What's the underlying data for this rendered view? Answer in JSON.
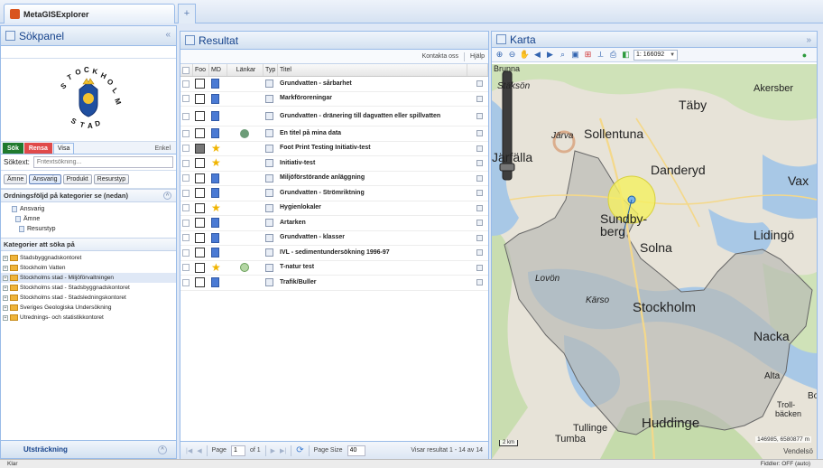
{
  "app": {
    "title": "MetaGISExplorer"
  },
  "left": {
    "title": "Sökpanel",
    "tabs": {
      "sok": "Sök",
      "rensa": "Rensa",
      "visa": "Visa",
      "enkel": "Enkel"
    },
    "soktext_label": "Söktext:",
    "soktext_placeholder": "Fritextsökning...",
    "filter_buttons": [
      "Ämne",
      "Ansvarig",
      "Produkt",
      "Resurstyp"
    ],
    "order_header": "Ordningsföljd på kategorier se (nedan)",
    "order_items": [
      "Ansvarig",
      "Ämne",
      "Resurstyp"
    ],
    "categories_header": "Kategorier att söka på",
    "categories": [
      "Stadsbyggnadskontoret",
      "Stockholm Vatten",
      "Stockholms stad - Miljöförvaltningen",
      "Stockholms stad - Stadsbyggnadskontoret",
      "Stockholms stad - Stadsledningskontoret",
      "Sveriges Geologiska Undersökning",
      "Utrednings- och statistikkontoret"
    ],
    "footer": "Utsträckning"
  },
  "mid": {
    "title": "Resultat",
    "toolbar": {
      "contact": "Kontakta oss",
      "help": "Hjälp"
    },
    "columns": {
      "foo": "Foo",
      "md": "MD",
      "lankar": "Länkar",
      "typ": "Typ",
      "titel": "Titel"
    },
    "rows": [
      {
        "title": "Grundvatten - sårbarhet",
        "md": "doc",
        "link": "",
        "foo_dark": false
      },
      {
        "title": "Markföroreningar",
        "md": "doc",
        "link": "",
        "foo_dark": false
      },
      {
        "title": "Grundvatten - dränering till dagvatten eller spillvatten",
        "md": "doc",
        "link": "",
        "foo_dark": false
      },
      {
        "title": "En titel på mina data",
        "md": "doc",
        "link": "globe",
        "foo_dark": false
      },
      {
        "title": "Foot Print Testing Initiativ-test",
        "md": "star",
        "link": "",
        "foo_dark": true
      },
      {
        "title": "Initiativ-test",
        "md": "star",
        "link": "",
        "foo_dark": false
      },
      {
        "title": "Miljöförstörande anläggning",
        "md": "doc",
        "link": "",
        "foo_dark": false
      },
      {
        "title": "Grundvatten - Strömriktning",
        "md": "doc",
        "link": "",
        "foo_dark": false
      },
      {
        "title": "Hygienlokaler",
        "md": "star",
        "link": "",
        "foo_dark": false
      },
      {
        "title": "Artarken",
        "md": "doc",
        "link": "",
        "foo_dark": false
      },
      {
        "title": "Grundvatten - klasser",
        "md": "doc",
        "link": "",
        "foo_dark": false
      },
      {
        "title": "IVL - sedimentundersökning 1996-97",
        "md": "doc",
        "link": "",
        "foo_dark": false
      },
      {
        "title": "T-natur test",
        "md": "star",
        "link": "leaf",
        "foo_dark": false
      },
      {
        "title": "Trafik/Buller",
        "md": "doc",
        "link": "",
        "foo_dark": false
      }
    ],
    "pager": {
      "page_label": "Page",
      "page_value": "1",
      "of_label": "of 1",
      "page_size_label": "Page Size",
      "page_size_value": "40",
      "summary": "Visar resultat 1 - 14 av 14"
    }
  },
  "map": {
    "title": "Karta",
    "scale": "1: 166092",
    "labels": [
      "Täby",
      "Sollentuna",
      "Järva",
      "Järfälla",
      "Danderyd",
      "Vax",
      "Sundby-",
      "berg",
      "Solna",
      "Lidingö",
      "Akersber",
      "Stäksön",
      "Lovön",
      "Kärso",
      "Stockholm",
      "Nacka",
      "Alta",
      "Troll-",
      "bäcken",
      "Bo",
      "Tullinge",
      "Tumba",
      "Huddinge",
      "Brunna"
    ],
    "scalebar": "2 km",
    "coords": "146985, 6580877 m",
    "corner_text": "Vendelsö"
  },
  "status": {
    "left": "Klar",
    "right": "Fiddler: OFF (auto)"
  }
}
